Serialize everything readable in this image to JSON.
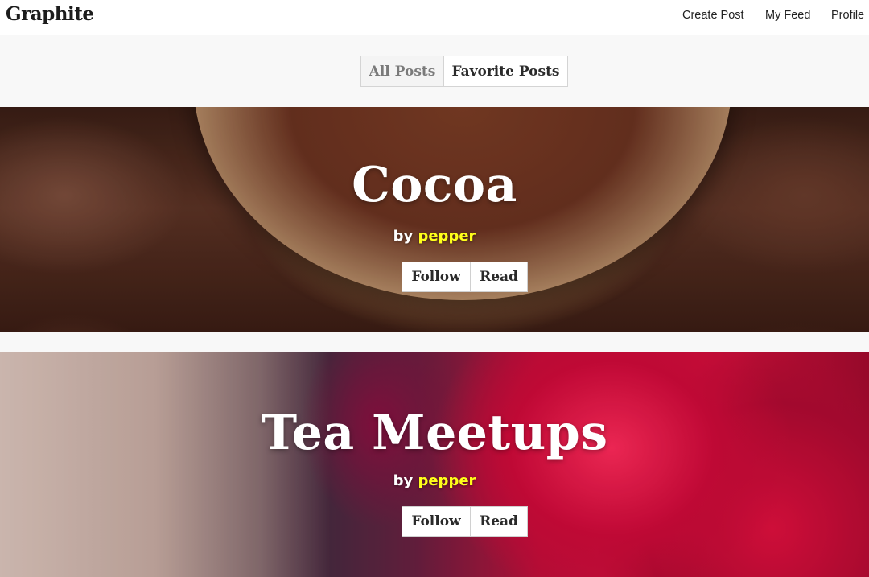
{
  "header": {
    "brand": "Graphite",
    "nav": [
      {
        "label": "Create Post"
      },
      {
        "label": "My Feed"
      },
      {
        "label": "Profile"
      }
    ]
  },
  "tabs": [
    {
      "label": "All Posts",
      "active": false
    },
    {
      "label": "Favorite Posts",
      "active": true
    }
  ],
  "posts": [
    {
      "title": "Cocoa",
      "by_label": "by",
      "author": "pepper",
      "follow_label": "Follow",
      "read_label": "Read",
      "cover": "cocoa-beans-photo"
    },
    {
      "title": "Tea Meetups",
      "by_label": "by",
      "author": "pepper",
      "follow_label": "Follow",
      "read_label": "Read",
      "cover": "red-teapot-photo"
    }
  ],
  "colors": {
    "author_highlight": "#ffff1a",
    "page_background": "#f8f8f8",
    "header_background": "#ffffff"
  }
}
